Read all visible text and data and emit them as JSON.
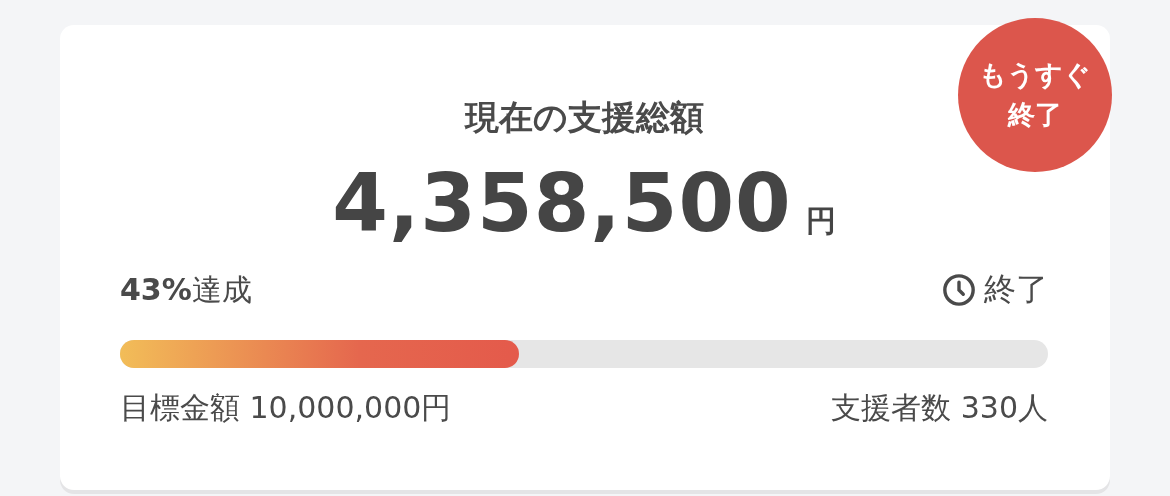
{
  "badge": {
    "lines": [
      "もうすぐ",
      "終了"
    ]
  },
  "title": "現在の支援総額",
  "amount": {
    "value": "4,358,500",
    "unit": "円"
  },
  "progress": {
    "achieved": "**43%**達成",
    "status": "終了",
    "level": 0.43
  },
  "goal": "目標金額 10,000,000円",
  "supporters": "支援者数 330人"
}
